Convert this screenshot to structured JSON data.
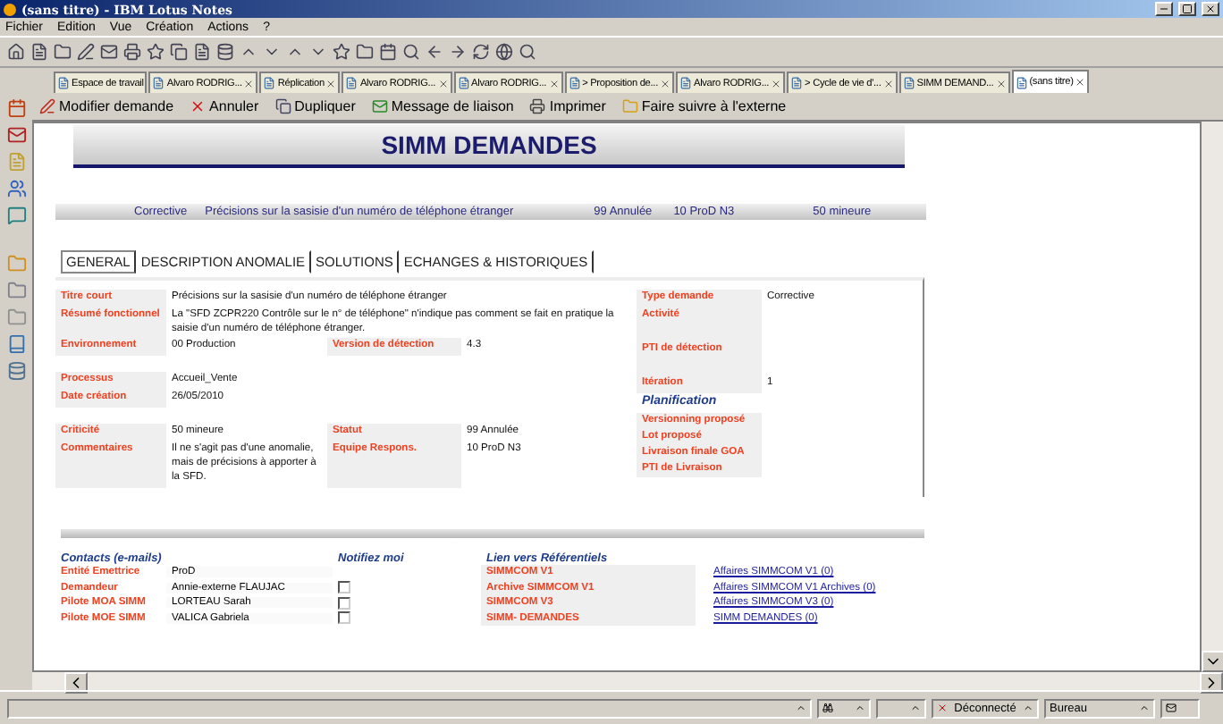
{
  "window": {
    "title": "(sans titre) - IBM Lotus Notes"
  },
  "menu": [
    "Fichier",
    "Edition",
    "Vue",
    "Création",
    "Actions",
    "?"
  ],
  "tabs": [
    {
      "label": "Espace de travail",
      "selected": false,
      "closable": false
    },
    {
      "label": "Alvaro RODRIG...",
      "selected": false,
      "closable": true
    },
    {
      "label": "Réplication",
      "selected": false,
      "closable": true
    },
    {
      "label": "Alvaro RODRIG...",
      "selected": false,
      "closable": true
    },
    {
      "label": "Alvaro RODRIG...",
      "selected": false,
      "closable": true
    },
    {
      "label": "> Proposition de...",
      "selected": false,
      "closable": true
    },
    {
      "label": "Alvaro RODRIG...",
      "selected": false,
      "closable": true
    },
    {
      "label": "> Cycle de vie d'...",
      "selected": false,
      "closable": true
    },
    {
      "label": "SIMM DEMAND...",
      "selected": false,
      "closable": true
    },
    {
      "label": "(sans titre)",
      "selected": true,
      "closable": true
    }
  ],
  "actions": [
    {
      "label": "Modifier demande",
      "kind": "edit"
    },
    {
      "label": "Annuler",
      "kind": "cancel"
    },
    {
      "label": "Dupliquer",
      "kind": "copy"
    },
    {
      "label": "Message de liaison",
      "kind": "mail"
    },
    {
      "label": "Imprimer",
      "kind": "print"
    },
    {
      "label": "Faire suivre à l'externe",
      "kind": "forward"
    }
  ],
  "document": {
    "title": "SIMM DEMANDES",
    "summary": [
      "Corrective",
      "Précisions sur la sasisie d'un numéro de téléphone étranger",
      "99 Annulée",
      "10 ProD N3",
      "50 mineure"
    ],
    "form_tabs": [
      {
        "label": "GENERAL",
        "selected": true
      },
      {
        "label": "DESCRIPTION ANOMALIE",
        "selected": false
      },
      {
        "label": "SOLUTIONS",
        "selected": false
      },
      {
        "label": "ECHANGES & HISTORIQUES",
        "selected": false
      }
    ],
    "left_fields": [
      {
        "kind": "wide",
        "label": "Titre court",
        "value": "Précisions sur la sasisie d'un numéro de téléphone étranger"
      },
      {
        "kind": "wide",
        "label": "Résumé fonctionnel",
        "value": "La \"SFD ZCPR220 Contrôle sur le n° de téléphone\" n'indique pas comment se fait en pratique la saisie d'un numéro de téléphone étranger."
      },
      {
        "kind": "pair",
        "label": "Environnement",
        "value": "00 Production",
        "label2": "Version de détection",
        "value2": "4.3"
      },
      {
        "kind": "gap"
      },
      {
        "kind": "pair",
        "label": "Processus",
        "value": "Accueil_Vente"
      },
      {
        "kind": "pair",
        "label": "Date création",
        "value": "26/05/2010"
      },
      {
        "kind": "gap"
      },
      {
        "kind": "pair",
        "label": "Criticité",
        "value": "50 mineure",
        "label2": "Statut",
        "value2": "99 Annulée"
      },
      {
        "kind": "pair",
        "label": "Commentaires",
        "value": "Il ne s'agit pas d'une anomalie, mais de précisions à apporter à la SFD.",
        "label2": "Equipe Respons.",
        "value2": "10 ProD N3"
      }
    ],
    "right_fields": [
      {
        "kind": "field",
        "label": "Type demande",
        "value": "Corrective"
      },
      {
        "kind": "field",
        "label": "Activité",
        "tall": true
      },
      {
        "kind": "field",
        "label": "PTI de détection",
        "tall": true
      },
      {
        "kind": "field",
        "label": "Itération",
        "value": "1"
      },
      {
        "kind": "heading",
        "label": "Planification"
      },
      {
        "kind": "field",
        "label": "Versionning proposé"
      },
      {
        "kind": "field",
        "label": "Lot proposé"
      },
      {
        "kind": "field",
        "label": "Livraison finale GOA"
      },
      {
        "kind": "field",
        "label": "PTI de Livraison"
      }
    ],
    "contacts": {
      "heading": "Contacts (e-mails)",
      "notify_heading": "Notifiez moi",
      "links_heading": "Lien vers Référentiels",
      "rows": [
        {
          "label": "Entité Emettrice",
          "value": "ProD",
          "kind": "plain",
          "ref": "SIMMCOM V1",
          "link": "Affaires SIMMCOM V1 (0)"
        },
        {
          "label": "Demandeur",
          "value": "Annie-externe FLAUJAC",
          "kind": "notify",
          "checked": false,
          "ref": "Archive SIMMCOM V1",
          "link": "Affaires SIMMCOM V1 Archives (0)"
        },
        {
          "label": "Pilote MOA SIMM",
          "value": "LORTEAU Sarah",
          "kind": "notify",
          "checked": false,
          "ref": "SIMMCOM V3",
          "link": "Affaires SIMMCOM V3 (0)"
        },
        {
          "label": "Pilote MOE SIMM",
          "value": "VALICA Gabriela",
          "kind": "notify",
          "checked": false,
          "ref": "SIMM- DEMANDES",
          "link": "SIMM DEMANDES (0)"
        }
      ]
    }
  },
  "status_bar": {
    "connection": "Déconnecté",
    "location": "Bureau"
  }
}
